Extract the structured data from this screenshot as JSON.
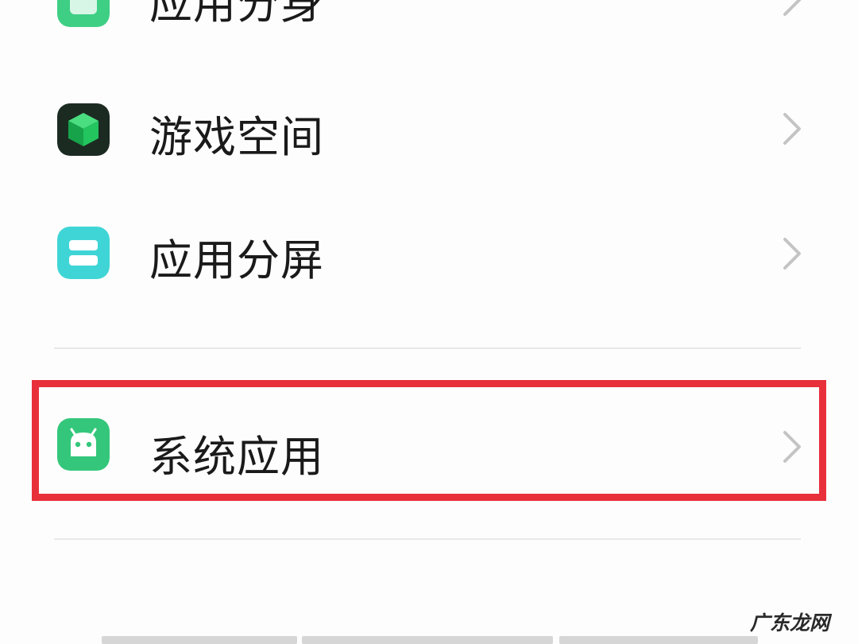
{
  "items": [
    {
      "label": "应用分身",
      "icon": "app-clone-icon",
      "color": "#3ecf85"
    },
    {
      "label": "游戏空间",
      "icon": "game-cube-icon",
      "color": "#22c55e"
    },
    {
      "label": "应用分屏",
      "icon": "split-screen-icon",
      "color": "#3fd5d6"
    },
    {
      "label": "系统应用",
      "icon": "android-robot-icon",
      "color": "#34c77b"
    }
  ],
  "highlight_color": "#e8303a",
  "watermark": "广东龙网"
}
